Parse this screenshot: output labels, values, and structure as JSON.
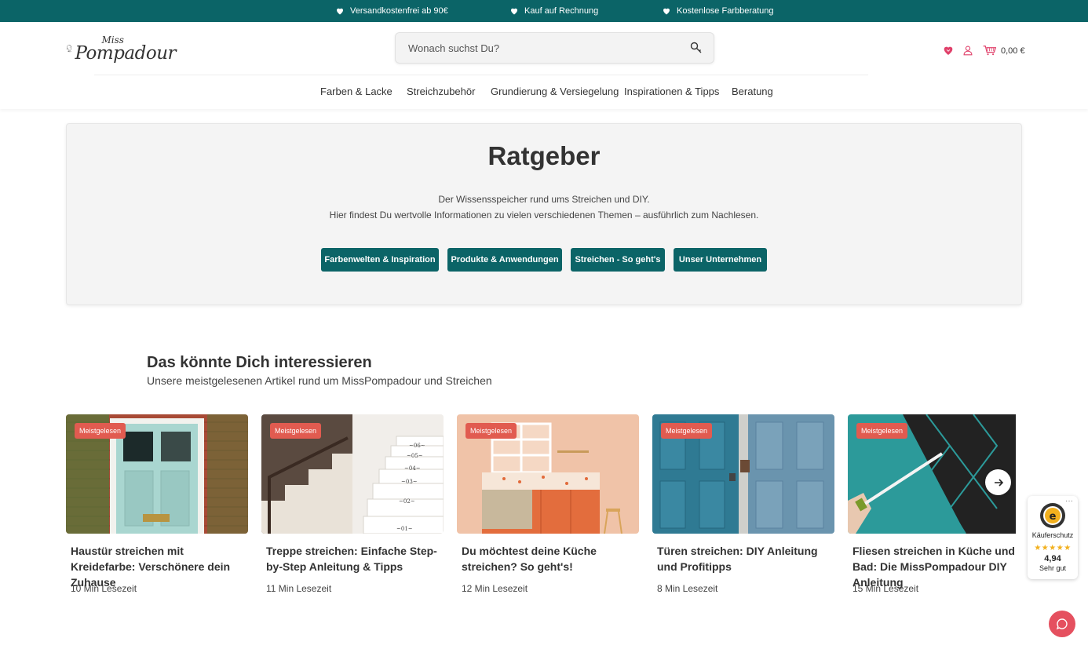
{
  "topbar": {
    "items": [
      {
        "label": "Versandkostenfrei ab 90€",
        "icon": "heart-icon"
      },
      {
        "label": "Kauf auf Rechnung",
        "icon": "heart-icon"
      },
      {
        "label": "Kostenlose Farbberatung",
        "icon": "heart-icon"
      }
    ]
  },
  "header": {
    "logo": {
      "miss": "Miss",
      "pompadour": "Pompadour"
    },
    "search": {
      "placeholder": "Wonach suchst Du?"
    },
    "cart_amount": "0,00 €",
    "icons": [
      "wishlist-heart-icon",
      "user-icon",
      "cart-icon",
      "search-icon"
    ]
  },
  "nav": {
    "items": [
      {
        "label": "Farben & Lacke"
      },
      {
        "label": "Streichzubehör"
      },
      {
        "label": "Grundierung & Versiegelung"
      },
      {
        "label": "Inspirationen & Tipps"
      },
      {
        "label": "Beratung"
      }
    ]
  },
  "hero": {
    "title": "Ratgeber",
    "line1": "Der Wissensspeicher rund ums Streichen und DIY.",
    "line2": "Hier findest Du wertvolle Informationen zu vielen verschiedenen Themen – ausführlich zum Nachlesen.",
    "buttons": [
      {
        "label": "Farbenwelten & Inspiration"
      },
      {
        "label": "Produkte & Anwendungen"
      },
      {
        "label": "Streichen - So geht's"
      },
      {
        "label": "Unser Unternehmen"
      }
    ]
  },
  "section": {
    "title": "Das könnte Dich interessieren",
    "subtitle": "Unsere meistgelesenen Artikel rund um MissPompadour und Streichen"
  },
  "articles": [
    {
      "badge": "Meistgelesen",
      "title": "Haustür streichen mit Kreidefarbe: Verschönere dein Zuhause",
      "meta": "10 Min Lesezeit"
    },
    {
      "badge": "Meistgelesen",
      "title": "Treppe streichen: Einfache Step-by-Step Anleitung & Tipps",
      "meta": "11 Min Lesezeit"
    },
    {
      "badge": "Meistgelesen",
      "title": "Du möchtest deine Küche streichen? So geht's!",
      "meta": "12 Min Lesezeit"
    },
    {
      "badge": "Meistgelesen",
      "title": "Türen streichen: DIY Anleitung und Profitipps",
      "meta": "8 Min Lesezeit"
    },
    {
      "badge": "Meistgelesen",
      "title": "Fliesen streichen in Küche und Bad: Die MissPompadour DIY Anleitung",
      "meta": "15 Min Lesezeit"
    }
  ],
  "trust": {
    "dots": "···",
    "label": "Käuferschutz",
    "stars": "★★★★★",
    "score": "4,94",
    "rating": "Sehr gut"
  },
  "colors": {
    "primary": "#0b6467",
    "badge": "#e15b50",
    "chat": "#e5505f",
    "accent_heart": "#e0406a"
  }
}
